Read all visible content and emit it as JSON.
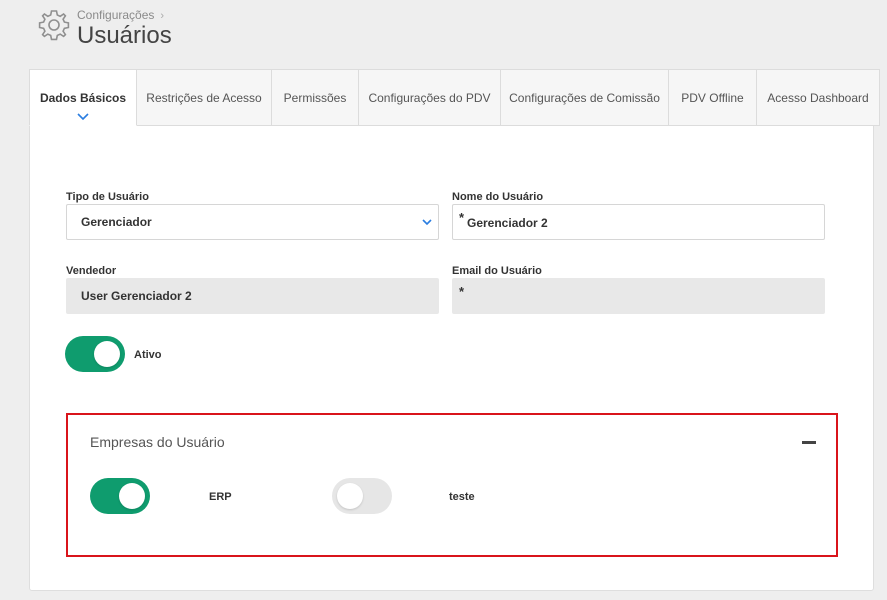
{
  "header": {
    "breadcrumb": "Configurações",
    "breadcrumb_sep": "›",
    "title": "Usuários"
  },
  "tabs": [
    {
      "label": "Dados Básicos",
      "active": true
    },
    {
      "label": "Restrições de Acesso",
      "active": false
    },
    {
      "label": "Permissões",
      "active": false
    },
    {
      "label": "Configurações do PDV",
      "active": false
    },
    {
      "label": "Configurações de Comissão",
      "active": false
    },
    {
      "label": "PDV Offline",
      "active": false
    },
    {
      "label": "Acesso Dashboard",
      "active": false
    }
  ],
  "form": {
    "tipo_label": "Tipo de Usuário",
    "tipo_value": "Gerenciador",
    "nome_label": "Nome do Usuário",
    "nome_required": "*",
    "nome_value": "Gerenciador 2",
    "vendedor_label": "Vendedor",
    "vendedor_value": "User Gerenciador 2",
    "email_label": "Email do Usuário",
    "email_required": "*",
    "email_value": "",
    "ativo_label": "Ativo",
    "ativo_on": true
  },
  "empresas": {
    "title": "Empresas do Usuário",
    "items": [
      {
        "label": "ERP",
        "on": true
      },
      {
        "label": "teste",
        "on": false
      }
    ]
  },
  "colors": {
    "accent": "#0f9c6e",
    "highlight_border": "#d9141b",
    "link_blue": "#2a7de1"
  }
}
